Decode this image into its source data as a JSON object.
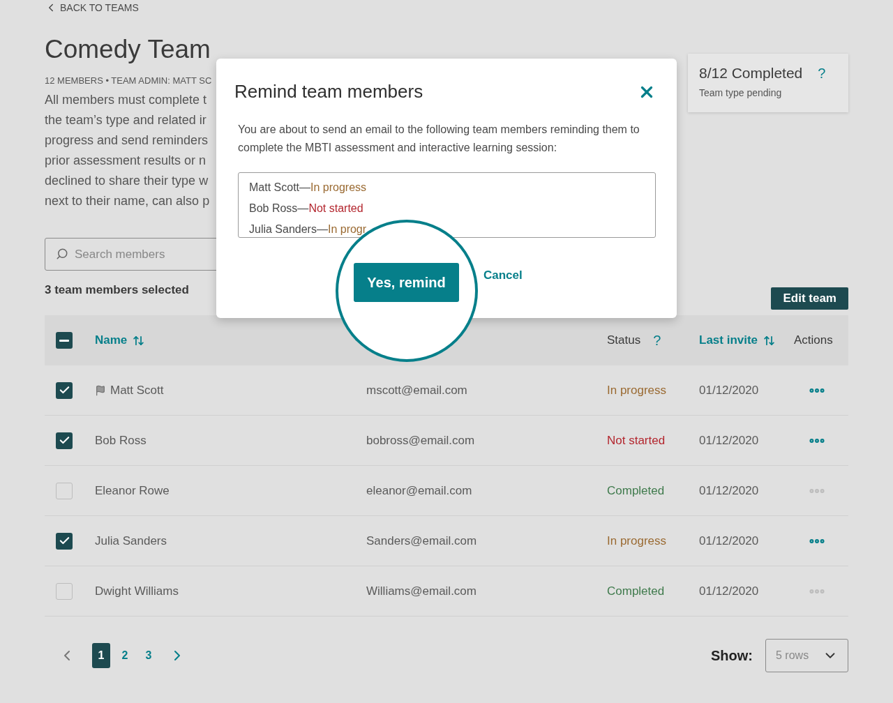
{
  "back_link": "BACK TO TEAMS",
  "team": {
    "title": "Comedy Team",
    "meta": "12 MEMBERS • TEAM ADMIN: MATT SC",
    "description_lines": [
      "All members must complete t",
      "the team’s type and related ir",
      "progress and send reminders",
      "prior assessment results or n",
      "declined to share their type w",
      "next to their name, can also p"
    ]
  },
  "progress_card": {
    "completed": "8/12 Completed",
    "help": "?",
    "subtitle": "Team type pending"
  },
  "search": {
    "placeholder": "Search members"
  },
  "selection_summary": "3 team members selected",
  "edit_button": "Edit team",
  "table": {
    "select_all_partial": true,
    "headers": {
      "name": {
        "label": "Name",
        "sortable": true
      },
      "status": {
        "label": "Status",
        "help": "?"
      },
      "last_invite": {
        "label": "Last invite",
        "sortable": true
      },
      "actions": {
        "label": "Actions",
        "sortable": false
      }
    },
    "rows": [
      {
        "name": "Matt Scott",
        "flagged": true,
        "email": "mscott@email.com",
        "status": "In progress",
        "color": "#9a6a32",
        "last_invite": "01/12/2020",
        "selected": true
      },
      {
        "name": "Bob Ross",
        "flagged": false,
        "email": "bobross@email.com",
        "status": "Not started",
        "color": "#b3262e",
        "last_invite": "01/12/2020",
        "selected": true
      },
      {
        "name": "Eleanor Rowe",
        "flagged": false,
        "email": "eleanor@email.com",
        "status": "Completed",
        "color": "#3f7a4c",
        "last_invite": "01/12/2020",
        "selected": false
      },
      {
        "name": "Julia Sanders",
        "flagged": false,
        "email": "Sanders@email.com",
        "status": "In progress",
        "color": "#9a6a32",
        "last_invite": "01/12/2020",
        "selected": true
      },
      {
        "name": "Dwight Williams",
        "flagged": false,
        "email": "Williams@email.com",
        "status": "Completed",
        "color": "#3f7a4c",
        "last_invite": "01/12/2020",
        "selected": false
      }
    ]
  },
  "pagination": {
    "pages": [
      {
        "label": "1",
        "selected": true
      },
      {
        "label": "2",
        "selected": false
      },
      {
        "label": "3",
        "selected": false
      }
    ],
    "show_label": "Show:",
    "rows_option": "5 rows"
  },
  "modal": {
    "title": "Remind team members",
    "body": "You are about to send an email to the following team members reminding them to complete the MBTI assessment and interactive learning session:",
    "recipients": [
      {
        "name": "Matt Scott—",
        "status": "In progress",
        "color": "#9a6a32"
      },
      {
        "name": "Bob Ross—",
        "status": "Not started",
        "color": "#b3262e"
      },
      {
        "name": "Julia Sanders—",
        "status": "In progr",
        "color": "#9a6a32"
      }
    ],
    "confirm": "Yes, remind",
    "cancel": "Cancel"
  }
}
